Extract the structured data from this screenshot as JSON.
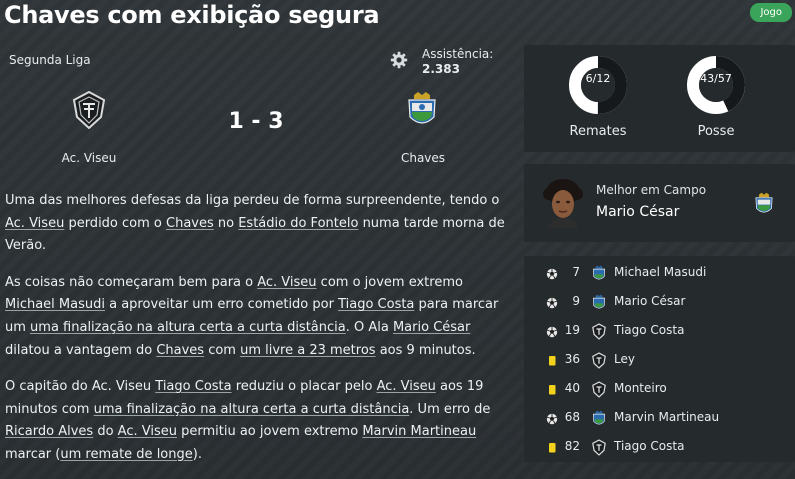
{
  "page": {
    "title": "Chaves com exibição segura",
    "status_button": "Jogo"
  },
  "match": {
    "league": "Segunda Liga",
    "attendance_label": "Assistência:",
    "attendance_value": "2.383",
    "home_team": "Ac. Viseu",
    "away_team": "Chaves",
    "score": "1 - 3"
  },
  "article": {
    "paragraphs": [
      [
        {
          "t": "Uma das melhores defesas da liga perdeu de forma surpreendente, tendo o "
        },
        {
          "t": "Ac. Viseu",
          "link": true
        },
        {
          "t": " perdido com o "
        },
        {
          "t": "Chaves",
          "link": true
        },
        {
          "t": " no "
        },
        {
          "t": "Estádio do Fontelo",
          "link": true
        },
        {
          "t": " numa tarde morna de Verão."
        }
      ],
      [
        {
          "t": "As coisas não começaram bem para o "
        },
        {
          "t": "Ac. Viseu",
          "link": true
        },
        {
          "t": " com o jovem extremo "
        },
        {
          "t": "Michael Masudi",
          "link": true
        },
        {
          "t": " a aproveitar um erro cometido por "
        },
        {
          "t": "Tiago Costa",
          "link": true
        },
        {
          "t": " para marcar um "
        },
        {
          "t": "uma finalização na altura certa a curta distância",
          "link": true
        },
        {
          "t": ". O Ala "
        },
        {
          "t": "Mario César",
          "link": true
        },
        {
          "t": " dilatou a vantagem do "
        },
        {
          "t": "Chaves",
          "link": true
        },
        {
          "t": " com "
        },
        {
          "t": "um livre a 23 metros",
          "link": true
        },
        {
          "t": " aos 9 minutos."
        }
      ],
      [
        {
          "t": "O capitão do Ac. Viseu "
        },
        {
          "t": "Tiago Costa",
          "link": true
        },
        {
          "t": " reduziu o placar pelo "
        },
        {
          "t": "Ac. Viseu",
          "link": true
        },
        {
          "t": " aos 19 minutos com "
        },
        {
          "t": "uma finalização na altura certa a curta distância",
          "link": true
        },
        {
          "t": ". Um erro de "
        },
        {
          "t": "Ricardo Alves",
          "link": true
        },
        {
          "t": " do "
        },
        {
          "t": "Ac. Viseu",
          "link": true
        },
        {
          "t": " permitiu ao jovem extremo "
        },
        {
          "t": "Marvin Martineau",
          "link": true
        },
        {
          "t": " marcar ("
        },
        {
          "t": "um remate de longe",
          "link": true
        },
        {
          "t": ")."
        }
      ]
    ]
  },
  "stats": {
    "shots": {
      "label": "Remates",
      "text": "6/12",
      "home": 6,
      "total": 12
    },
    "possession": {
      "label": "Posse",
      "text": "43/57",
      "home": 43,
      "total": 100
    }
  },
  "motm": {
    "title": "Melhor em Campo",
    "name": "Mario César"
  },
  "events": [
    {
      "type": "goal",
      "minute": "7",
      "team": "away",
      "player": "Michael Masudi"
    },
    {
      "type": "goal",
      "minute": "9",
      "team": "away",
      "player": "Mario César"
    },
    {
      "type": "goal",
      "minute": "19",
      "team": "home",
      "player": "Tiago Costa"
    },
    {
      "type": "yellow",
      "minute": "36",
      "team": "home",
      "player": "Ley"
    },
    {
      "type": "yellow",
      "minute": "40",
      "team": "home",
      "player": "Monteiro"
    },
    {
      "type": "goal",
      "minute": "68",
      "team": "away",
      "player": "Marvin Martineau"
    },
    {
      "type": "yellow",
      "minute": "82",
      "team": "home",
      "player": "Tiago Costa"
    }
  ],
  "colors": {
    "accent_green": "#3aa55a",
    "ring_track": "#ffffff",
    "ring_fill": "#15191b",
    "yellow_card": "#f2d21b",
    "home_crest": "#d9d9d9",
    "away_crest_blue": "#2b6cb0",
    "away_crest_green": "#3c9a3c"
  }
}
